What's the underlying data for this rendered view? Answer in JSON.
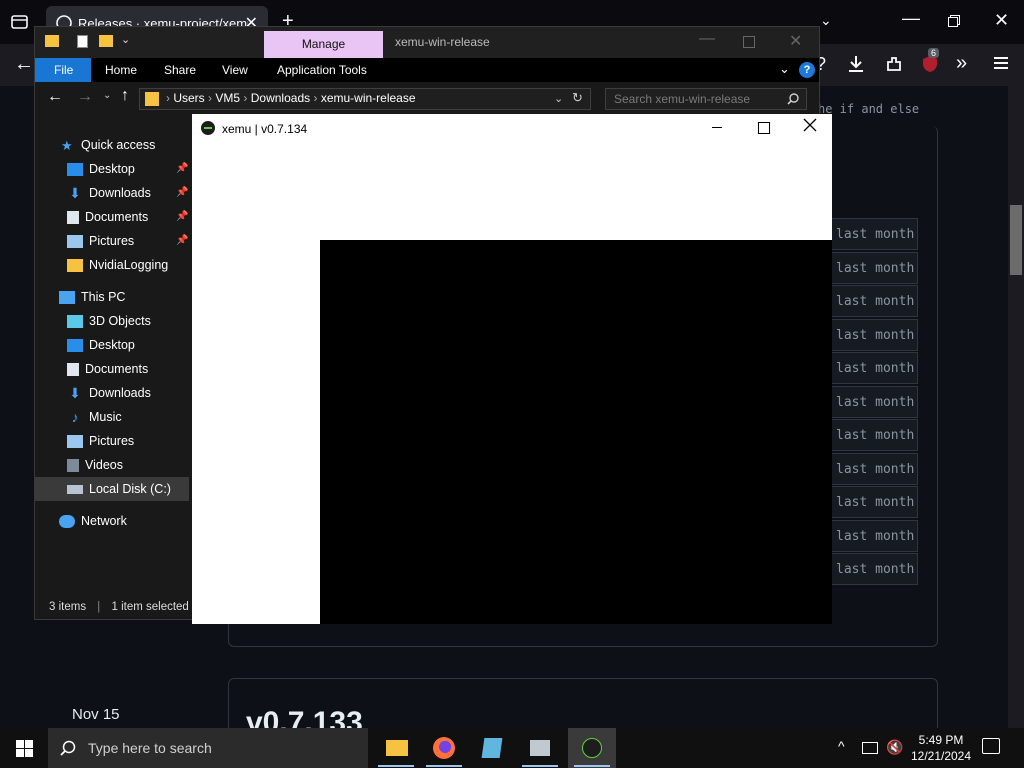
{
  "firefox": {
    "tab_title": "Releases · xemu-project/xemu",
    "badge_count": "6",
    "content_code_snippet": "he if and else",
    "release_rows": [
      "last month",
      "last month",
      "last month",
      "last month",
      "last month",
      "last month",
      "last month",
      "last month",
      "last month",
      "last month",
      "last month"
    ],
    "release_date": "Nov 15",
    "release_heading": "v0.7.133"
  },
  "explorer": {
    "manage_label": "Manage",
    "window_title": "xemu-win-release",
    "ribbon_tabs": {
      "file": "File",
      "home": "Home",
      "share": "Share",
      "view": "View",
      "app_tools": "Application Tools"
    },
    "breadcrumb": {
      "users": "Users",
      "vm": "VM5",
      "downloads": "Downloads",
      "folder": "xemu-win-release"
    },
    "search_placeholder": "Search xemu-win-release",
    "nav": {
      "quick_access": "Quick access",
      "qa_desktop": "Desktop",
      "qa_downloads": "Downloads",
      "qa_documents": "Documents",
      "qa_pictures": "Pictures",
      "qa_nvidia": "NvidiaLogging",
      "this_pc": "This PC",
      "pc_3d": "3D Objects",
      "pc_desktop": "Desktop",
      "pc_documents": "Documents",
      "pc_downloads": "Downloads",
      "pc_music": "Music",
      "pc_pictures": "Pictures",
      "pc_videos": "Videos",
      "pc_local_disk": "Local Disk (C:)",
      "network": "Network"
    },
    "status_items": "3 items",
    "status_selected": "1 item selected"
  },
  "xemu": {
    "title": "xemu | v0.7.134"
  },
  "taskbar": {
    "search_placeholder": "Type here to search",
    "time": "5:49 PM",
    "date": "12/21/2024"
  }
}
